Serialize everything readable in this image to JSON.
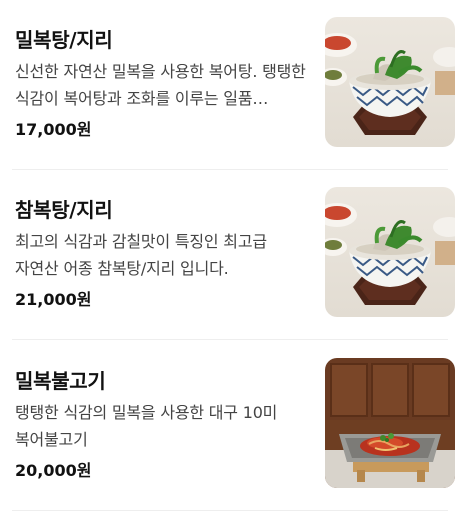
{
  "menu": {
    "items": [
      {
        "name": "밀복탕/지리",
        "description": "신선한 자연산 밀복을 사용한 복어탕. 탱탱한 식감이 복어탕과 조화를 이루는 일품 요리입니다.",
        "price": "17,000원",
        "image": "blowfish-soup-photo"
      },
      {
        "name": "참복탕/지리",
        "description": "최고의 식감과 감칠맛이 특징인 최고급 자연산 어종 참복탕/지리 입니다.",
        "price": "21,000원",
        "image": "blowfish-soup-photo"
      },
      {
        "name": "밀복불고기",
        "description": "탱탱한 식감의 밀복을 사용한 대구 10미 복어불고기",
        "price": "20,000원",
        "image": "blowfish-bulgogi-photo"
      }
    ]
  }
}
